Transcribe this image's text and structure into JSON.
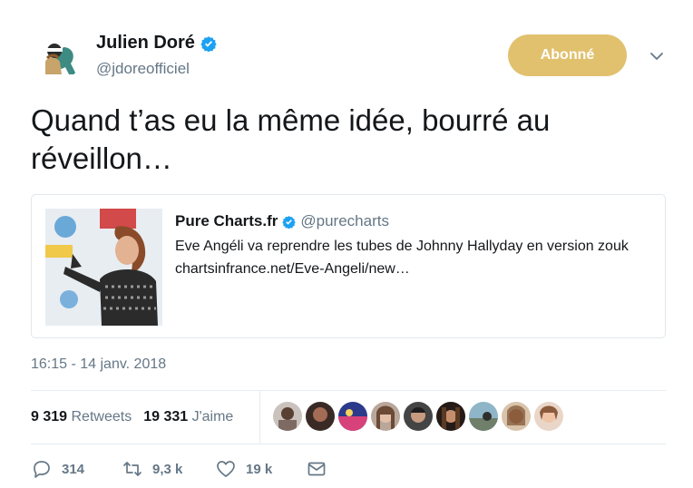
{
  "author": {
    "name": "Julien Doré",
    "handle": "@jdoreofficiel"
  },
  "follow_button": {
    "label": "Abonné"
  },
  "tweet": {
    "text": "Quand t’as eu la même idée, bourré au réveillon…",
    "timestamp": "16:15 - 14 janv. 2018"
  },
  "quote": {
    "name": "Pure Charts.fr",
    "handle": "@purecharts",
    "text": "Eve Angéli va reprendre les tubes de Johnny Hallyday en version zouk chartsinfrance.net/Eve-Angeli/new…"
  },
  "stats": {
    "retweets_count": "9 319",
    "retweets_label": "Retweets",
    "likes_count": "19 331",
    "likes_label": "J'aime"
  },
  "actions": {
    "replies": "314",
    "retweets": "9,3 k",
    "likes": "19 k"
  },
  "colors": {
    "follow_button": "#e1c16e",
    "verified": "#1da1f2",
    "muted": "#657786"
  }
}
